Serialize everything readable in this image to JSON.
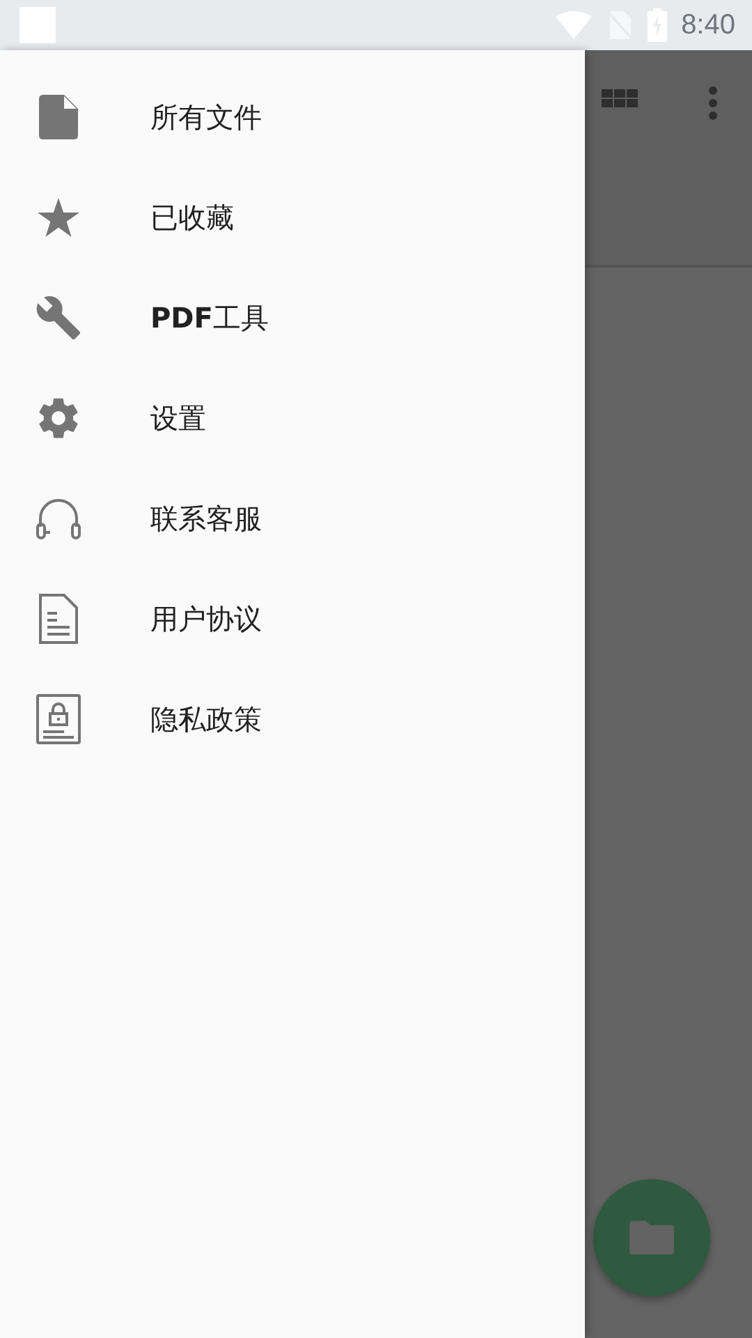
{
  "status_bar": {
    "time": "8:40"
  },
  "drawer": {
    "items": [
      {
        "kind": "file",
        "label": "所有文件"
      },
      {
        "kind": "star",
        "label": "已收藏"
      },
      {
        "kind": "wrench",
        "label": "**PDF**工具"
      },
      {
        "kind": "gear",
        "label": "设置"
      },
      {
        "kind": "headset",
        "label": "联系客服"
      },
      {
        "kind": "document",
        "label": "用户协议"
      },
      {
        "kind": "lock",
        "label": "隐私政策"
      }
    ]
  }
}
